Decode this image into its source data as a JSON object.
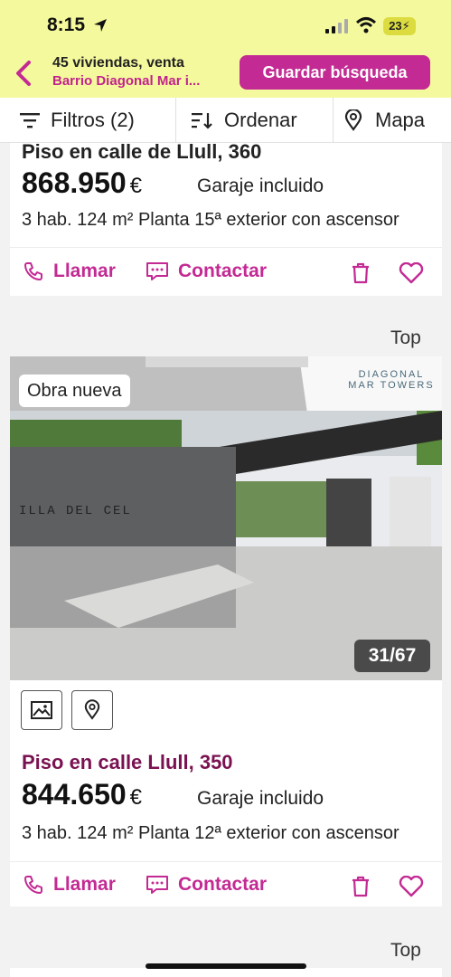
{
  "status": {
    "time": "8:15",
    "battery": "23"
  },
  "header": {
    "title": "45 viviendas, venta",
    "subtitle": "Barrio Diagonal Mar i...",
    "save_label": "Guardar búsqueda"
  },
  "toolbar": {
    "filters_label": "Filtros (2)",
    "order_label": "Ordenar",
    "map_label": "Mapa"
  },
  "listings": [
    {
      "title": "Piso en calle de Llull, 360",
      "price": "868.950",
      "currency": "€",
      "garage": "Garaje incluido",
      "specs": "3 hab.   124 m²   Planta 15ª exterior con ascensor"
    },
    {
      "badge": "Obra nueva",
      "photo_counter": "31/67",
      "photo_sign": "ILLA DEL CEL",
      "logo_text": "DIAGONAL MAR TOWERS",
      "title": "Piso en calle Llull, 350",
      "price": "844.650",
      "currency": "€",
      "garage": "Garaje incluido",
      "specs": "3 hab.   124 m²   Planta 12ª exterior con ascensor"
    }
  ],
  "actions": {
    "call_label": "Llamar",
    "contact_label": "Contactar"
  },
  "top_label": "Top",
  "colors": {
    "accent": "#c32a93",
    "header_bg": "#f5f99d",
    "title_dark": "#7a1151"
  }
}
